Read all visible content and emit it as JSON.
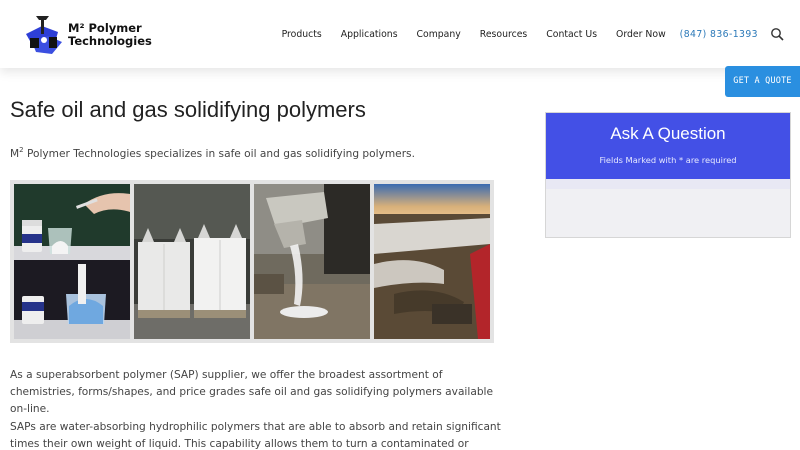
{
  "logo": {
    "line1": "M² Polymer",
    "line2": "Technologies"
  },
  "nav": {
    "items": [
      "Products",
      "Applications",
      "Company",
      "Resources",
      "Contact Us",
      "Order Now"
    ],
    "phone": "(847) 836-1393",
    "search_icon": "search-icon"
  },
  "quote_button": "GET A QUOTE",
  "main": {
    "title": "Safe oil and gas solidifying polymers",
    "intro_prefix": "M",
    "intro_sup": "2",
    "intro_rest": " Polymer Technologies specializes in safe oil and gas solidifying polymers.",
    "para1": "As a superabsorbent polymer (SAP) supplier, we offer the broadest assortment of chemistries, forms/shapes, and price grades safe oil and gas solidifying polymers available on-line.",
    "para2": "SAPs are water-absorbing hydrophilic polymers that are able to absorb and retain significant times their own weight of liquid. This capability allows them to turn a contaminated or"
  },
  "sidebar": {
    "title": "Ask A Question",
    "subtitle": "Fields Marked with * are required"
  },
  "colors": {
    "accent": "#4350e6",
    "button": "#2a8fe0",
    "phone": "#2a78b8"
  }
}
